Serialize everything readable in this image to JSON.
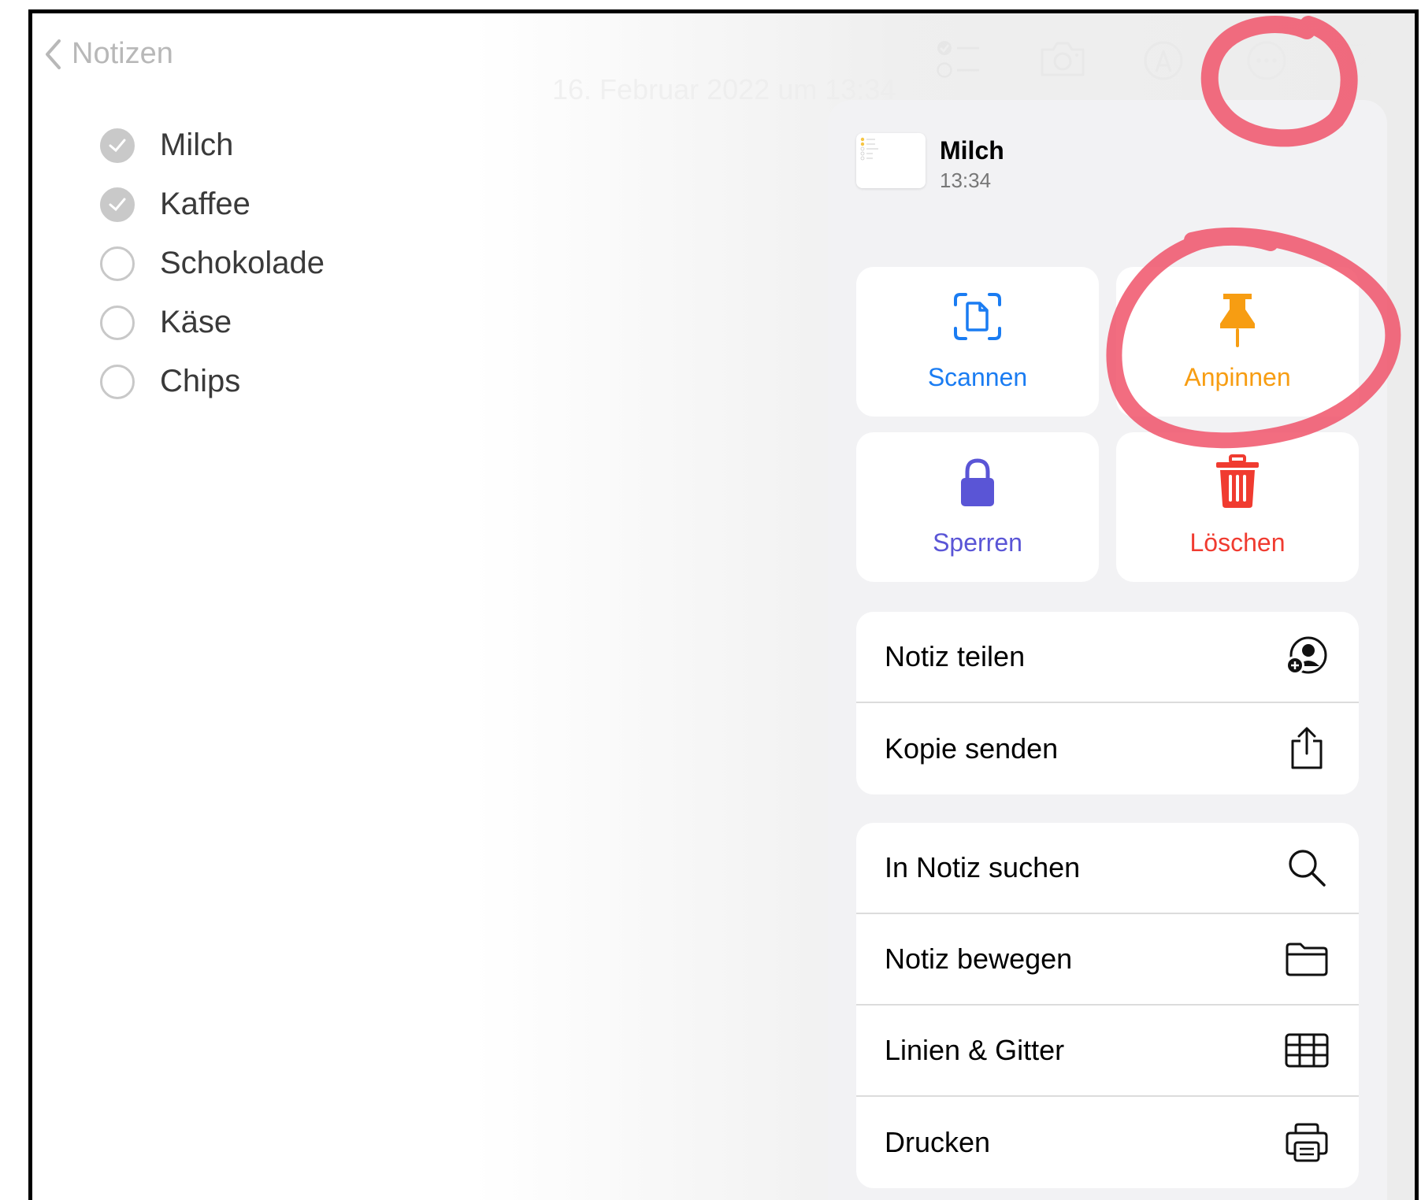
{
  "nav": {
    "back_label": "Notizen"
  },
  "note_date": "16. Februar 2022 um 13:34",
  "toolbar": {
    "icons": [
      "checklist-icon",
      "camera-icon",
      "markup-icon",
      "more-icon",
      "compose-icon"
    ]
  },
  "checklist": [
    {
      "text": "Milch",
      "checked": true
    },
    {
      "text": "Kaffee",
      "checked": true
    },
    {
      "text": "Schokolade",
      "checked": false
    },
    {
      "text": "Käse",
      "checked": false
    },
    {
      "text": "Chips",
      "checked": false
    }
  ],
  "menu": {
    "note_title": "Milch",
    "note_time": "13:34",
    "tiles": [
      {
        "label": "Scannen",
        "icon": "scan-document-icon",
        "color": "#1a7cf2"
      },
      {
        "label": "Anpinnen",
        "icon": "pin-icon",
        "color": "#f79d12"
      },
      {
        "label": "Sperren",
        "icon": "lock-icon",
        "color": "#5a55d6"
      },
      {
        "label": "Löschen",
        "icon": "trash-icon",
        "color": "#f03b30"
      }
    ],
    "group1": [
      {
        "label": "Notiz teilen",
        "icon": "share-person-icon"
      },
      {
        "label": "Kopie senden",
        "icon": "share-icon"
      }
    ],
    "group2": [
      {
        "label": "In Notiz suchen",
        "icon": "search-icon"
      },
      {
        "label": "Notiz bewegen",
        "icon": "folder-icon"
      },
      {
        "label": "Linien & Gitter",
        "icon": "grid-icon"
      },
      {
        "label": "Drucken",
        "icon": "printer-icon"
      }
    ]
  },
  "colors": {
    "annotation": "#f0546a"
  }
}
